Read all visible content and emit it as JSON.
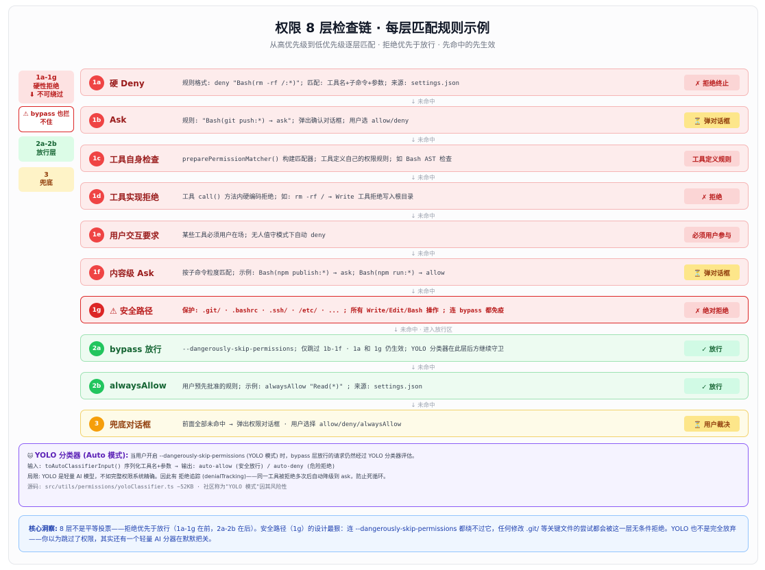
{
  "header": {
    "title": "权限 8 层检查链 · 每层匹配规则示例",
    "subtitle": "从高优先级到低优先级逐层匹配 · 拒绝优先于放行 · 先命中的先生效"
  },
  "legend": {
    "hard": [
      "1a-1g",
      "硬性拒绝",
      "⬇ 不可绕过"
    ],
    "bypass": [
      "⚠ bypass 也拦",
      "不住"
    ],
    "allow": [
      "2a-2b",
      "放行层"
    ],
    "fallback": [
      "3",
      "兜底"
    ]
  },
  "layers": [
    {
      "id": "1a",
      "name": "硬 Deny",
      "desc": "规则格式: deny \"Bash(rm -rf /:*)\"; 匹配: 工具名+子命令+参数; 来源: settings.json",
      "action": "✗ 拒绝终止"
    },
    {
      "id": "1b",
      "name": "Ask",
      "desc": "规则: \"Bash(git push:*) → ask\"; 弹出确认对话框; 用户选 allow/deny",
      "action": "⏳ 弹对话框"
    },
    {
      "id": "1c",
      "name": "工具自身检查",
      "desc": "preparePermissionMatcher() 构建匹配器; 工具定义自己的权限规则; 如 Bash AST 检查",
      "action": "工具定义规则"
    },
    {
      "id": "1d",
      "name": "工具实现拒绝",
      "desc": "工具 call() 方法内硬编码拒绝; 如: rm -rf / → Write 工具拒绝写入根目录",
      "action": "✗ 拒绝"
    },
    {
      "id": "1e",
      "name": "用户交互要求",
      "desc": "某些工具必须用户在场; 无人值守模式下自动 deny",
      "action": "必须用户参与"
    },
    {
      "id": "1f",
      "name": "内容级 Ask",
      "desc": "按子命令粒度匹配; 示例: Bash(npm publish:*) → ask; Bash(npm run:*) → allow",
      "action": "⏳ 弹对话框"
    },
    {
      "id": "1g",
      "name": "⚠ 安全路径",
      "desc": "保护: .git/ · .bashrc · .ssh/ · /etc/ · ... ; 所有 Write/Edit/Bash 操作 ; 连 bypass 都免疫",
      "action": "✗ 绝对拒绝"
    },
    {
      "id": "2a",
      "name": "bypass 放行",
      "desc": "--dangerously-skip-permissions; 仅跳过 1b-1f · 1a 和 1g 仍生效; YOLO 分类器在此层后方继续守卫",
      "action": "✓ 放行"
    },
    {
      "id": "2b",
      "name": "alwaysAllow",
      "desc": "用户预先批准的规则; 示例: alwaysAllow \"Read(*)\" ; 来源: settings.json",
      "action": "✓ 放行"
    },
    {
      "id": "3",
      "name": "兜底对话框",
      "desc": "前面全部未命中 → 弹出权限对话框 · 用户选择 allow/deny/alwaysAllow",
      "action": "⏳ 用户裁决"
    }
  ],
  "connectors": {
    "miss": "↓ 未命中",
    "miss_enter_allow": "↓ 未命中 · 进入放行区"
  },
  "yolo": {
    "icon": "🐱",
    "title": "YOLO 分类器 (Auto 模式):",
    "line1": "当用户开启 --dangerously-skip-permissions (YOLO 模式) 时，bypass 层放行的请求仍然经过 YOLO 分类器评估。",
    "line2": "输入: toAutoClassifierInput() 序列化工具名+参数 → 输出: auto-allow (安全放行) / auto-deny (危险拒绝)",
    "line3": "局限: YOLO 是轻量 AI 模型，不如完整权限系统精确。因此有 拒绝追踪 (denialTracking)——同一工具被拒绝多次后自动降级到 ask，防止死循环。",
    "line4": "源码: src/utils/permissions/yoloClassifier.ts ~52KB · 社区称为\"YOLO 模式\"因其风险性"
  },
  "insight": {
    "label": "核心洞察:",
    "text": "8 层不是平等投票——拒绝优先于放行（1a-1g 在前，2a-2b 在后）。安全路径（1g）的设计最狠：连 --dangerously-skip-permissions 都绕不过它，任何修改 .git/ 等关键文件的尝试都会被这一层无条件拒绝。YOLO 也不是完全放弃——你以为跳过了权限，其实还有一个轻量 AI 分器在默默把关。"
  }
}
